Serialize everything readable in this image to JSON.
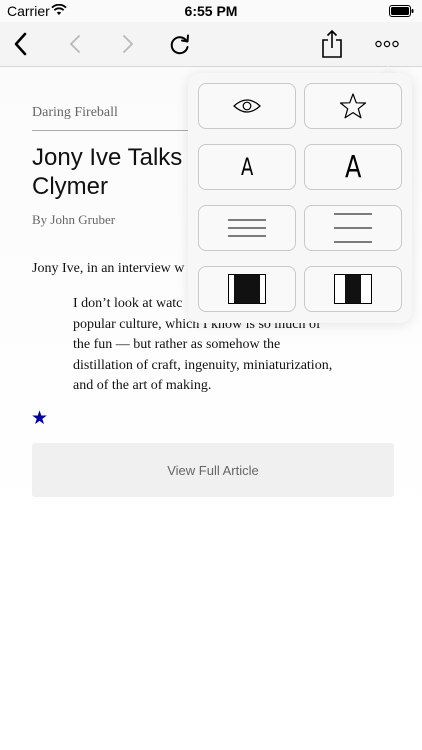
{
  "status_bar": {
    "carrier": "Carrier",
    "time": "6:55 PM",
    "icons": [
      "wifi-icon",
      "battery-icon"
    ]
  },
  "toolbar": {
    "icons": [
      "back-chevron-icon",
      "previous-article-icon",
      "next-article-icon",
      "reload-icon",
      "share-icon",
      "more-icon"
    ]
  },
  "article": {
    "source": "Daring Fireball",
    "title": "Jony Ive Talks W\nClymer",
    "byline": "By John Gruber",
    "lead": "Jony Ive, in an interview w",
    "quote": "I don’t look at watc\npopular culture, which I know is so much of\nthe fun — but rather as somehow the\ndistillation of craft, ingenuity, miniaturization,\nand of the art of making.",
    "star": "★",
    "view_full_label": "View Full Article"
  },
  "menu": {
    "font_small_label": "A",
    "font_large_label": "A",
    "icons": [
      "eye-icon",
      "star-outline-icon",
      "line-spacing-narrow-icon",
      "line-spacing-wide-icon",
      "margin-wide-icon",
      "margin-narrow-icon"
    ]
  },
  "colors": {
    "accent_star": "#0000a0",
    "toolbar_bg": "#f4f4f4",
    "popover_bg": "#f7f7f7"
  }
}
